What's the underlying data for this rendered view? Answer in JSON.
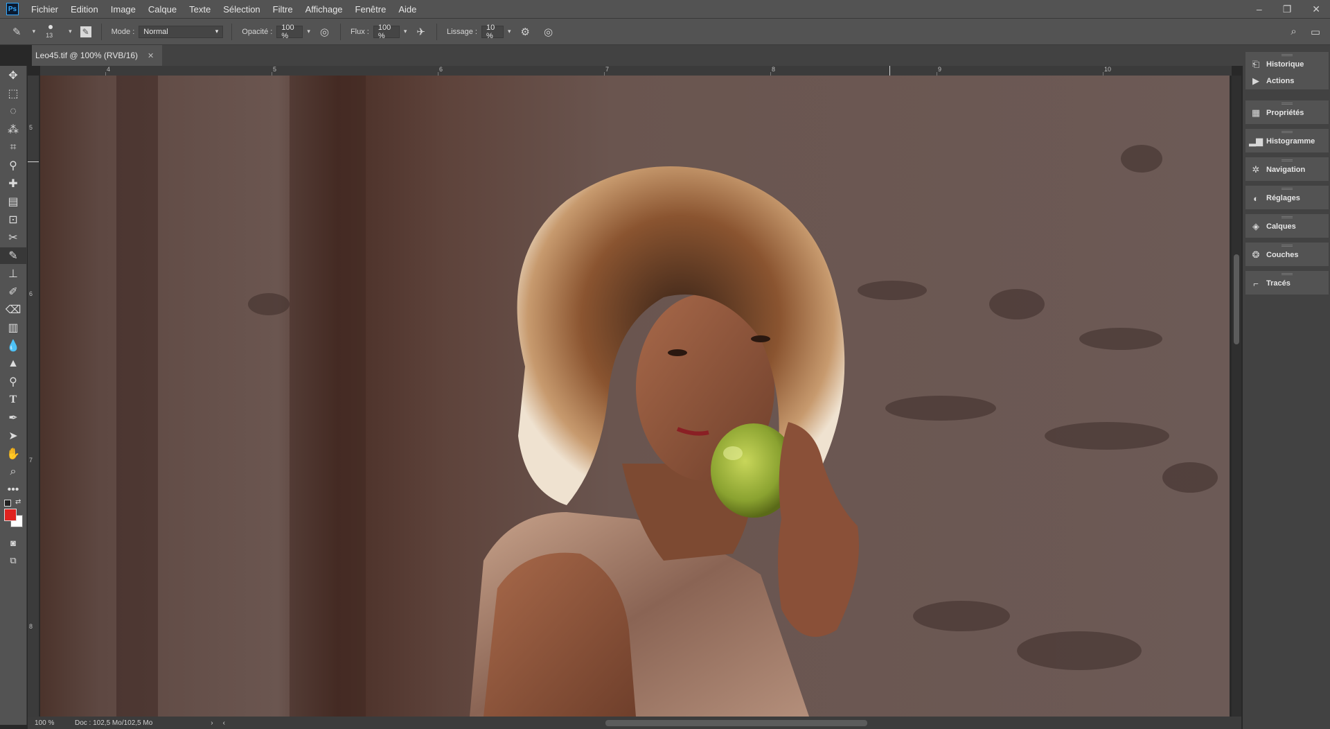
{
  "app": {
    "logo": "Ps"
  },
  "menu": [
    "Fichier",
    "Edition",
    "Image",
    "Calque",
    "Texte",
    "Sélection",
    "Filtre",
    "Affichage",
    "Fenêtre",
    "Aide"
  ],
  "options": {
    "brush_size": "13",
    "mode_label": "Mode :",
    "mode_value": "Normal",
    "opacity_label": "Opacité :",
    "opacity_value": "100 %",
    "flux_label": "Flux :",
    "flux_value": "100 %",
    "lissage_label": "Lissage :",
    "lissage_value": "10 %"
  },
  "document": {
    "tab_title": "Leo45.tif @ 100% (RVB/16)",
    "zoom": "100 %",
    "doc_info": "Doc : 102,5 Mo/102,5 Mo"
  },
  "rulers": {
    "top": [
      "4",
      "5",
      "6",
      "7",
      "8",
      "9",
      "10"
    ],
    "left": [
      "5",
      "6",
      "7",
      "8"
    ]
  },
  "colors": {
    "foreground": "#e0221f",
    "background": "#ffffff",
    "accent": "#31a8ff"
  },
  "panels": {
    "group1": [
      {
        "label": "Historique",
        "icon": "history-icon"
      },
      {
        "label": "Actions",
        "icon": "play-icon"
      }
    ],
    "rest": [
      {
        "label": "Propriétés",
        "icon": "properties-icon"
      },
      {
        "label": "Histogramme",
        "icon": "histogram-icon"
      },
      {
        "label": "Navigation",
        "icon": "navigator-icon"
      },
      {
        "label": "Réglages",
        "icon": "adjustments-icon"
      },
      {
        "label": "Calques",
        "icon": "layers-icon"
      },
      {
        "label": "Couches",
        "icon": "channels-icon"
      },
      {
        "label": "Tracés",
        "icon": "paths-icon"
      }
    ]
  }
}
